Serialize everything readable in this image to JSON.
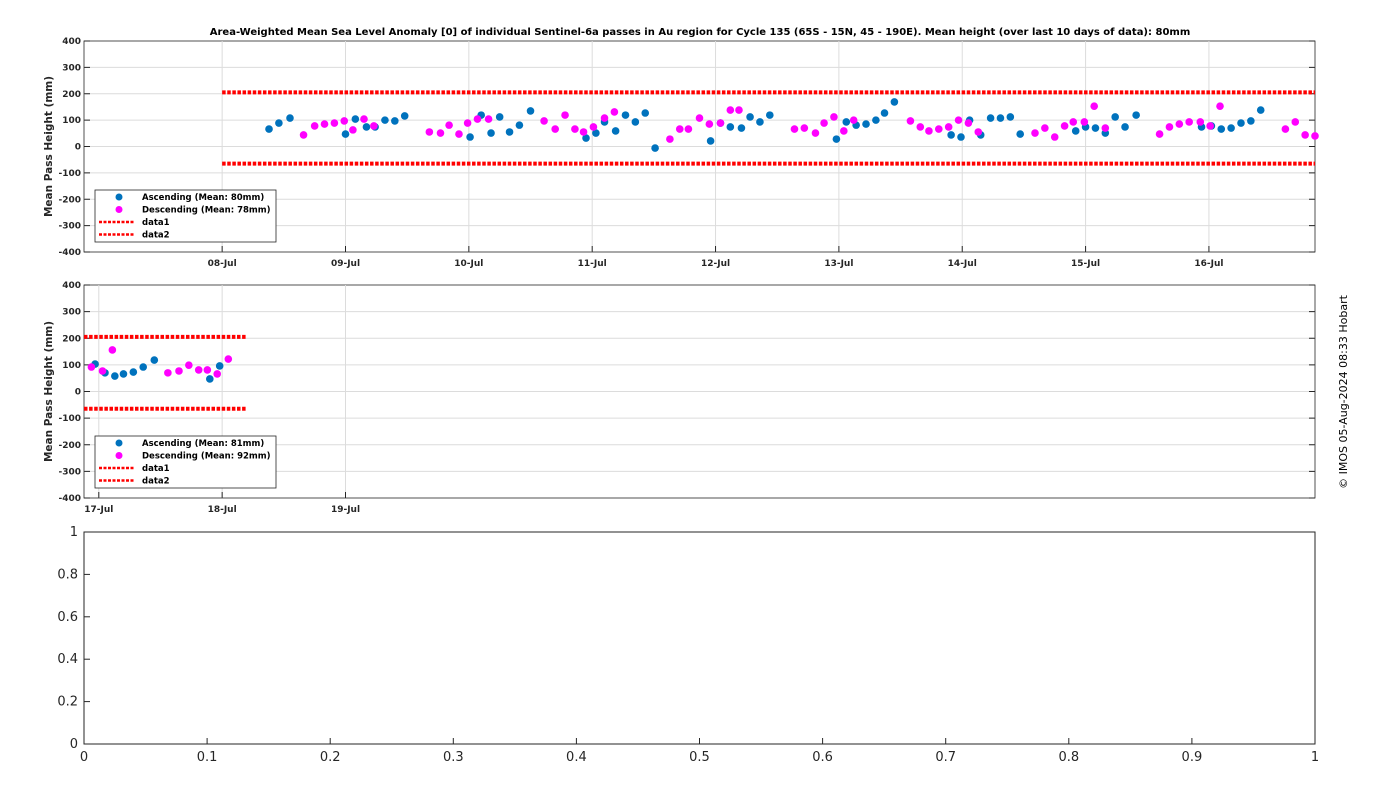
{
  "title": "Area-Weighted Mean Sea Level Anomaly [0] of individual Sentinel-6a passes in Au region for Cycle 135 (65S - 15N, 45 - 190E). Mean height (over last 10 days of data): 80mm",
  "copyright": "© IMOS 05-Aug-2024 08:33 Hobart",
  "colors": {
    "ascending": "#0072BD",
    "descending": "#FF00FF",
    "limits": "#FF0000",
    "grid": "#dcdcdc"
  },
  "chart_data": [
    {
      "type": "scatter",
      "title": "Area-Weighted Mean Sea Level Anomaly [0] of individual Sentinel-6a passes in Au region for Cycle 135 (65S - 15N, 45 - 190E). Mean height (over last 10 days of data): 80mm",
      "xlabel": "",
      "ylabel": "Mean Pass Height (mm)",
      "x_units": "days since 08-Jul",
      "xlim": [
        -1.12,
        8.86
      ],
      "ylim": [
        -400,
        400
      ],
      "yticks": [
        "400",
        "300",
        "200",
        "100",
        "0",
        "-100",
        "-200",
        "-300",
        "-400"
      ],
      "xticks": [
        {
          "x": 0,
          "label": "08-Jul"
        },
        {
          "x": 1,
          "label": "09-Jul"
        },
        {
          "x": 2,
          "label": "10-Jul"
        },
        {
          "x": 3,
          "label": "11-Jul"
        },
        {
          "x": 4,
          "label": "12-Jul"
        },
        {
          "x": 5,
          "label": "13-Jul"
        },
        {
          "x": 6,
          "label": "14-Jul"
        },
        {
          "x": 7,
          "label": "15-Jul"
        },
        {
          "x": 8,
          "label": "16-Jul"
        }
      ],
      "grid": true,
      "legend_position": "bottom-left",
      "series": [
        {
          "name": "Ascending (Mean: 80mm)",
          "kind": "points",
          "color": "#0072BD",
          "x": [
            0.38,
            0.46,
            0.55,
            1.0,
            1.08,
            1.17,
            1.24,
            1.32,
            1.4,
            1.48,
            2.01,
            2.1,
            2.18,
            2.25,
            2.33,
            2.41,
            2.5,
            2.95,
            3.03,
            3.1,
            3.19,
            3.27,
            3.35,
            3.43,
            3.51,
            3.96,
            4.04,
            4.12,
            4.21,
            4.28,
            4.36,
            4.44,
            4.98,
            5.06,
            5.14,
            5.22,
            5.3,
            5.37,
            5.45,
            5.91,
            5.99,
            6.06,
            6.15,
            6.23,
            6.31,
            6.39,
            6.47,
            6.92,
            7.0,
            7.08,
            7.16,
            7.24,
            7.32,
            7.41,
            7.94,
            8.02,
            8.1,
            8.18,
            8.26,
            8.34,
            8.42
          ],
          "y": [
            66,
            89,
            108,
            47,
            104,
            74,
            74,
            100,
            97,
            116,
            36,
            119,
            51,
            112,
            55,
            81,
            135,
            32,
            51,
            93,
            59,
            119,
            93,
            127,
            -6,
            21,
            89,
            74,
            70,
            112,
            93,
            119,
            28,
            93,
            81,
            85,
            100,
            127,
            169,
            44,
            36,
            100,
            44,
            108,
            108,
            112,
            47,
            59,
            74,
            70,
            51,
            112,
            74,
            119,
            74,
            78,
            66,
            70,
            89,
            97,
            138
          ]
        },
        {
          "name": "Descending (Mean: 78mm)",
          "kind": "points",
          "color": "#FF00FF",
          "x": [
            0.66,
            0.75,
            0.83,
            0.91,
            0.99,
            1.06,
            1.15,
            1.23,
            1.68,
            1.77,
            1.84,
            1.92,
            1.99,
            2.07,
            2.16,
            2.61,
            2.7,
            2.78,
            2.86,
            2.93,
            3.01,
            3.1,
            3.18,
            3.63,
            3.71,
            3.78,
            3.87,
            3.95,
            4.04,
            4.12,
            4.19,
            4.64,
            4.72,
            4.81,
            4.88,
            4.96,
            5.04,
            5.12,
            5.58,
            5.66,
            5.73,
            5.81,
            5.89,
            5.97,
            6.05,
            6.13,
            6.59,
            6.67,
            6.75,
            6.83,
            6.9,
            6.99,
            7.07,
            7.16,
            7.6,
            7.68,
            7.76,
            7.84,
            7.93,
            8.01,
            8.09,
            8.62,
            8.7,
            8.78,
            8.86
          ],
          "y": [
            44,
            78,
            85,
            89,
            97,
            63,
            104,
            78,
            55,
            51,
            81,
            47,
            89,
            104,
            104,
            97,
            66,
            119,
            66,
            55,
            74,
            108,
            131,
            28,
            66,
            66,
            108,
            85,
            89,
            138,
            138,
            66,
            70,
            51,
            89,
            112,
            59,
            100,
            97,
            74,
            59,
            66,
            74,
            100,
            89,
            55,
            51,
            70,
            36,
            78,
            93,
            93,
            153,
            70,
            47,
            74,
            85,
            93,
            93,
            78,
            153,
            66,
            93,
            44,
            40
          ]
        },
        {
          "name": "data1",
          "kind": "line",
          "color": "#FF0000",
          "x": [
            0,
            8.86
          ],
          "y": [
            205,
            205
          ]
        },
        {
          "name": "data2",
          "kind": "line",
          "color": "#FF0000",
          "x": [
            0,
            8.86
          ],
          "y": [
            -65,
            -65
          ]
        }
      ]
    },
    {
      "type": "scatter",
      "title": "",
      "xlabel": "",
      "ylabel": "Mean Pass Height (mm)",
      "x_units": "days since 17-Jul",
      "xlim": [
        -0.12,
        9.86
      ],
      "ylim": [
        -400,
        400
      ],
      "yticks": [
        "400",
        "300",
        "200",
        "100",
        "0",
        "-100",
        "-200",
        "-300",
        "-400"
      ],
      "xticks": [
        {
          "x": 0,
          "label": "17-Jul"
        },
        {
          "x": 1,
          "label": "18-Jul"
        },
        {
          "x": 2,
          "label": "19-Jul"
        }
      ],
      "grid": true,
      "legend_position": "bottom-left",
      "series": [
        {
          "name": "Ascending (Mean: 81mm)",
          "kind": "points",
          "color": "#0072BD",
          "x": [
            -0.03,
            0.05,
            0.13,
            0.2,
            0.28,
            0.36,
            0.45,
            0.9,
            0.98
          ],
          "y": [
            103,
            70,
            58,
            66,
            73,
            92,
            118,
            47,
            96
          ]
        },
        {
          "name": "Descending (Mean: 92mm)",
          "kind": "points",
          "color": "#FF00FF",
          "x": [
            -0.06,
            0.03,
            0.11,
            0.56,
            0.65,
            0.73,
            0.81,
            0.88,
            0.96,
            1.05
          ],
          "y": [
            92,
            77,
            156,
            70,
            77,
            99,
            81,
            81,
            66,
            122
          ]
        },
        {
          "name": "data1",
          "kind": "line",
          "color": "#FF0000",
          "x": [
            -0.12,
            1.19
          ],
          "y": [
            205,
            205
          ]
        },
        {
          "name": "data2",
          "kind": "line",
          "color": "#FF0000",
          "x": [
            -0.12,
            1.19
          ],
          "y": [
            -65,
            -65
          ]
        }
      ]
    },
    {
      "type": "line",
      "title": "",
      "xlabel": "",
      "ylabel": "",
      "xlim": [
        0,
        1
      ],
      "ylim": [
        0,
        1
      ],
      "xticks": [
        {
          "x": 0,
          "label": "0"
        },
        {
          "x": 0.1,
          "label": "0.1"
        },
        {
          "x": 0.2,
          "label": "0.2"
        },
        {
          "x": 0.3,
          "label": "0.3"
        },
        {
          "x": 0.4,
          "label": "0.4"
        },
        {
          "x": 0.5,
          "label": "0.5"
        },
        {
          "x": 0.6,
          "label": "0.6"
        },
        {
          "x": 0.7,
          "label": "0.7"
        },
        {
          "x": 0.8,
          "label": "0.8"
        },
        {
          "x": 0.9,
          "label": "0.9"
        },
        {
          "x": 1,
          "label": "1"
        }
      ],
      "yticks": [
        "1",
        "0.8",
        "0.6",
        "0.4",
        "0.2",
        "0"
      ],
      "grid": false,
      "series": []
    }
  ]
}
